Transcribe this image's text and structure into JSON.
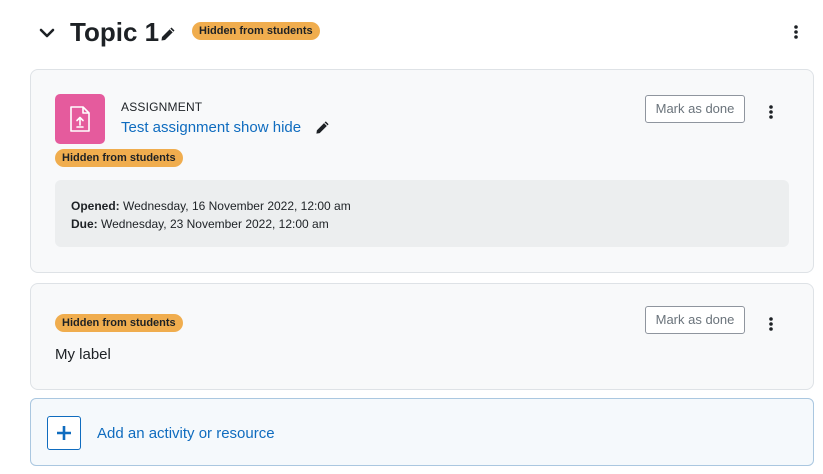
{
  "topic": {
    "title": "Topic 1",
    "badge": "Hidden from students",
    "icons": {
      "collapse": "chevron-down-icon",
      "edit": "pencil-icon",
      "menu": "kebab-menu-icon"
    }
  },
  "activities": [
    {
      "type": "ASSIGNMENT",
      "name": "Test assignment show hide",
      "badge": "Hidden from students",
      "opened_label": "Opened:",
      "opened_value": "Wednesday, 16 November 2022, 12:00 am",
      "due_label": "Due:",
      "due_value": "Wednesday, 23 November 2022, 12:00 am",
      "mark_done": "Mark as done",
      "icon": "assignment-icon"
    },
    {
      "badge": "Hidden from students",
      "text": "My label",
      "mark_done": "Mark as done"
    }
  ],
  "add_activity": {
    "label": "Add an activity or resource",
    "icon": "plus-icon"
  },
  "colors": {
    "badge_bg": "#f0ad4e",
    "link": "#0f6cbf",
    "assignment_icon_bg": "#e55b9d",
    "card_bg": "#f8f9fa"
  }
}
